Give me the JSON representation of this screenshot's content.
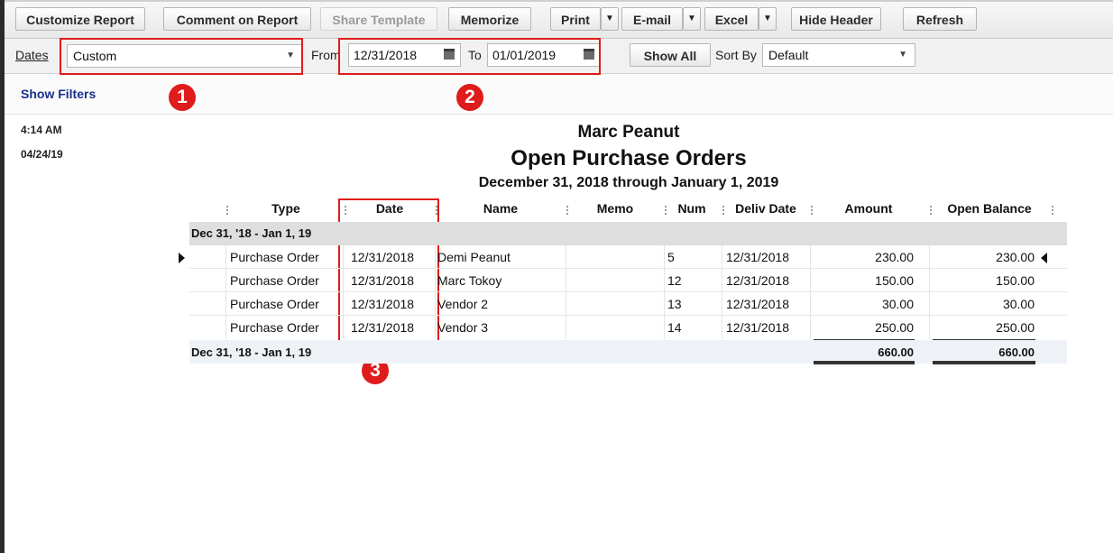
{
  "toolbar": {
    "customize": "Customize Report",
    "comment": "Comment on Report",
    "share": "Share Template",
    "memorize": "Memorize",
    "print": "Print",
    "email": "E-mail",
    "excel": "Excel",
    "hide_header": "Hide Header",
    "refresh": "Refresh"
  },
  "filters": {
    "dates_label": "Dates",
    "dates_value": "Custom",
    "from_label": "From",
    "from_value": "12/31/2018",
    "to_label": "To",
    "to_value": "01/01/2019",
    "show_all": "Show All",
    "sort_by_label": "Sort By",
    "sort_by_value": "Default",
    "show_filters": "Show Filters"
  },
  "annotations": {
    "badge1": "1",
    "badge2": "2",
    "badge3": "3"
  },
  "report_meta": {
    "time": "4:14 AM",
    "date": "04/24/19"
  },
  "report": {
    "company": "Marc Peanut",
    "title": "Open Purchase Orders",
    "period": "December 31, 2018 through January 1, 2019",
    "columns": [
      "Type",
      "Date",
      "Name",
      "Memo",
      "Num",
      "Deliv Date",
      "Amount",
      "Open Balance"
    ],
    "group_label": "Dec 31, '18 - Jan 1, 19",
    "rows": [
      {
        "type": "Purchase Order",
        "date": "12/31/2018",
        "name": "Demi Peanut",
        "memo": "",
        "num": "5",
        "deliv": "12/31/2018",
        "amount": "230.00",
        "open": "230.00"
      },
      {
        "type": "Purchase Order",
        "date": "12/31/2018",
        "name": "Marc Tokoy",
        "memo": "",
        "num": "12",
        "deliv": "12/31/2018",
        "amount": "150.00",
        "open": "150.00"
      },
      {
        "type": "Purchase Order",
        "date": "12/31/2018",
        "name": "Vendor 2",
        "memo": "",
        "num": "13",
        "deliv": "12/31/2018",
        "amount": "30.00",
        "open": "30.00"
      },
      {
        "type": "Purchase Order",
        "date": "12/31/2018",
        "name": "Vendor 3",
        "memo": "",
        "num": "14",
        "deliv": "12/31/2018",
        "amount": "250.00",
        "open": "250.00"
      }
    ],
    "total_label": "Dec 31, '18 - Jan 1, 19",
    "total_amount": "660.00",
    "total_open": "660.00"
  },
  "colors": {
    "annotation_red": "#e01b1b",
    "link_blue": "#1a2f8a"
  }
}
